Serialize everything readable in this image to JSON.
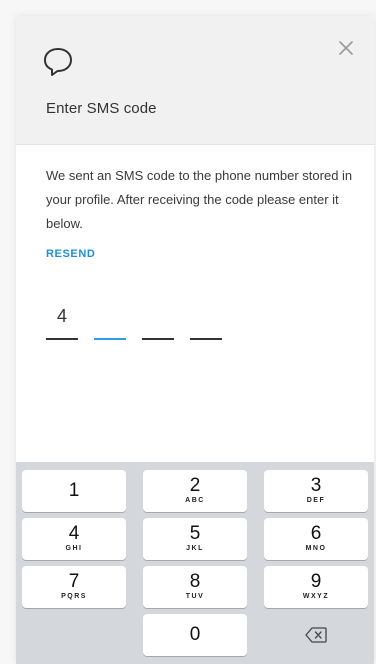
{
  "header": {
    "title": "Enter SMS code",
    "icon": "chat-bubble-icon",
    "close_icon": "close-icon"
  },
  "body": {
    "description": "We sent an SMS code to the phone number stored in your profile. After receiving the code please enter it below.",
    "resend_label": "RESEND"
  },
  "code": {
    "digits": [
      "4",
      "",
      "",
      ""
    ],
    "active_index": 1
  },
  "keyboard": {
    "keys": [
      {
        "num": "1",
        "letters": ""
      },
      {
        "num": "2",
        "letters": "ABC"
      },
      {
        "num": "3",
        "letters": "DEF"
      },
      {
        "num": "4",
        "letters": "GHI"
      },
      {
        "num": "5",
        "letters": "JKL"
      },
      {
        "num": "6",
        "letters": "MNO"
      },
      {
        "num": "7",
        "letters": "PQRS"
      },
      {
        "num": "8",
        "letters": "TUV"
      },
      {
        "num": "9",
        "letters": "WXYZ"
      },
      {
        "num": "0",
        "letters": ""
      }
    ],
    "backspace_icon": "backspace-icon"
  },
  "colors": {
    "accent": "#1f8fd6",
    "keyboard_bg": "#d4d7dc",
    "header_bg": "#f1f1f1"
  }
}
